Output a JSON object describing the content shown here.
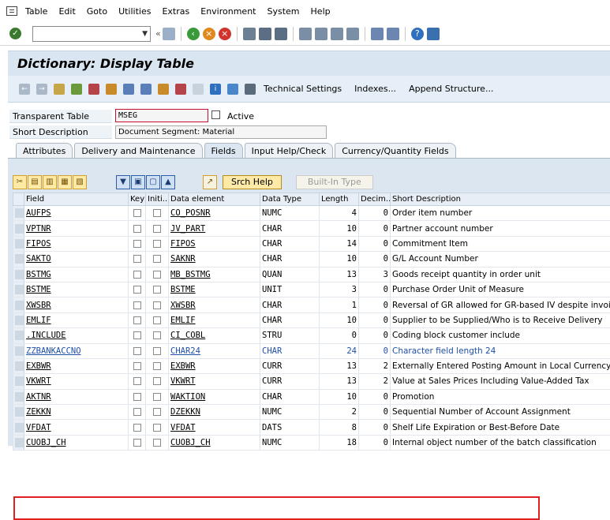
{
  "menu": {
    "items": [
      {
        "label": "Table"
      },
      {
        "label": "Edit"
      },
      {
        "label": "Goto"
      },
      {
        "label": "Utilities"
      },
      {
        "label": "Extras"
      },
      {
        "label": "Environment"
      },
      {
        "label": "System"
      },
      {
        "label": "Help"
      }
    ]
  },
  "command_field": {
    "value": ""
  },
  "screen": {
    "title": "Dictionary: Display Table",
    "app_toolbar": {
      "technical_settings": "Technical Settings",
      "indexes": "Indexes...",
      "append_structure": "Append Structure..."
    }
  },
  "header": {
    "table_label": "Transparent Table",
    "table_value": "MSEG",
    "status": "Active",
    "short_desc_label": "Short Description",
    "short_desc_value": "Document Segment: Material"
  },
  "tabs": [
    {
      "label": "Attributes",
      "active": false
    },
    {
      "label": "Delivery and Maintenance",
      "active": false
    },
    {
      "label": "Fields",
      "active": true
    },
    {
      "label": "Input Help/Check",
      "active": false
    },
    {
      "label": "Currency/Quantity Fields",
      "active": false
    }
  ],
  "table_toolbar": {
    "srch_help": "Srch Help",
    "built_in_type": "Built-In Type"
  },
  "columns": {
    "field": "Field",
    "key": "Key",
    "initial": "Initi...",
    "data_element": "Data element",
    "data_type": "Data Type",
    "length": "Length",
    "decimals": "Decim...",
    "short_desc": "Short Description"
  },
  "rows": [
    {
      "field": "AUFPS",
      "data_element": "CO_POSNR",
      "data_type": "NUMC",
      "length": "4",
      "decimals": "0",
      "desc": "Order item number"
    },
    {
      "field": "VPTNR",
      "data_element": "JV_PART",
      "data_type": "CHAR",
      "length": "10",
      "decimals": "0",
      "desc": "Partner account number"
    },
    {
      "field": "FIPOS",
      "data_element": "FIPOS",
      "data_type": "CHAR",
      "length": "14",
      "decimals": "0",
      "desc": "Commitment Item"
    },
    {
      "field": "SAKTO",
      "data_element": "SAKNR",
      "data_type": "CHAR",
      "length": "10",
      "decimals": "0",
      "desc": "G/L Account Number"
    },
    {
      "field": "BSTMG",
      "data_element": "MB_BSTMG",
      "data_type": "QUAN",
      "length": "13",
      "decimals": "3",
      "desc": "Goods receipt quantity in order unit"
    },
    {
      "field": "BSTME",
      "data_element": "BSTME",
      "data_type": "UNIT",
      "length": "3",
      "decimals": "0",
      "desc": "Purchase Order Unit of Measure"
    },
    {
      "field": "XWSBR",
      "data_element": "XWSBR",
      "data_type": "CHAR",
      "length": "1",
      "decimals": "0",
      "desc": "Reversal of GR allowed for GR-based IV despite invoice"
    },
    {
      "field": "EMLIF",
      "data_element": "EMLIF",
      "data_type": "CHAR",
      "length": "10",
      "decimals": "0",
      "desc": "Supplier to be Supplied/Who is to Receive Delivery"
    },
    {
      "field": ".INCLUDE",
      "data_element": "CI_COBL",
      "data_type": "STRU",
      "length": "0",
      "decimals": "0",
      "desc": "Coding block customer include"
    },
    {
      "field": "ZZBANKACCNO",
      "data_element": "CHAR24",
      "data_type": "CHAR",
      "length": "24",
      "decimals": "0",
      "desc": "Character field length 24"
    },
    {
      "field": "EXBWR",
      "data_element": "EXBWR",
      "data_type": "CURR",
      "length": "13",
      "decimals": "2",
      "desc": "Externally Entered Posting Amount in Local Currency"
    },
    {
      "field": "VKWRT",
      "data_element": "VKWRT",
      "data_type": "CURR",
      "length": "13",
      "decimals": "2",
      "desc": "Value at Sales Prices Including Value-Added Tax"
    },
    {
      "field": "AKTNR",
      "data_element": "WAKTION",
      "data_type": "CHAR",
      "length": "10",
      "decimals": "0",
      "desc": "Promotion"
    },
    {
      "field": "ZEKKN",
      "data_element": "DZEKKN",
      "data_type": "NUMC",
      "length": "2",
      "decimals": "0",
      "desc": "Sequential Number of Account Assignment"
    },
    {
      "field": "VFDAT",
      "data_element": "VFDAT",
      "data_type": "DATS",
      "length": "8",
      "decimals": "0",
      "desc": "Shelf Life Expiration or Best-Before Date"
    },
    {
      "field": "CUOBJ_CH",
      "data_element": "CUOBJ_CH",
      "data_type": "NUMC",
      "length": "18",
      "decimals": "0",
      "desc": "Internal object number of the batch classification"
    }
  ],
  "highlight_row_index": 9,
  "colors": {
    "highlight_text": "#1f4fa8",
    "highlight_box": "#e02020",
    "title_bg": "#d9e6f1"
  }
}
